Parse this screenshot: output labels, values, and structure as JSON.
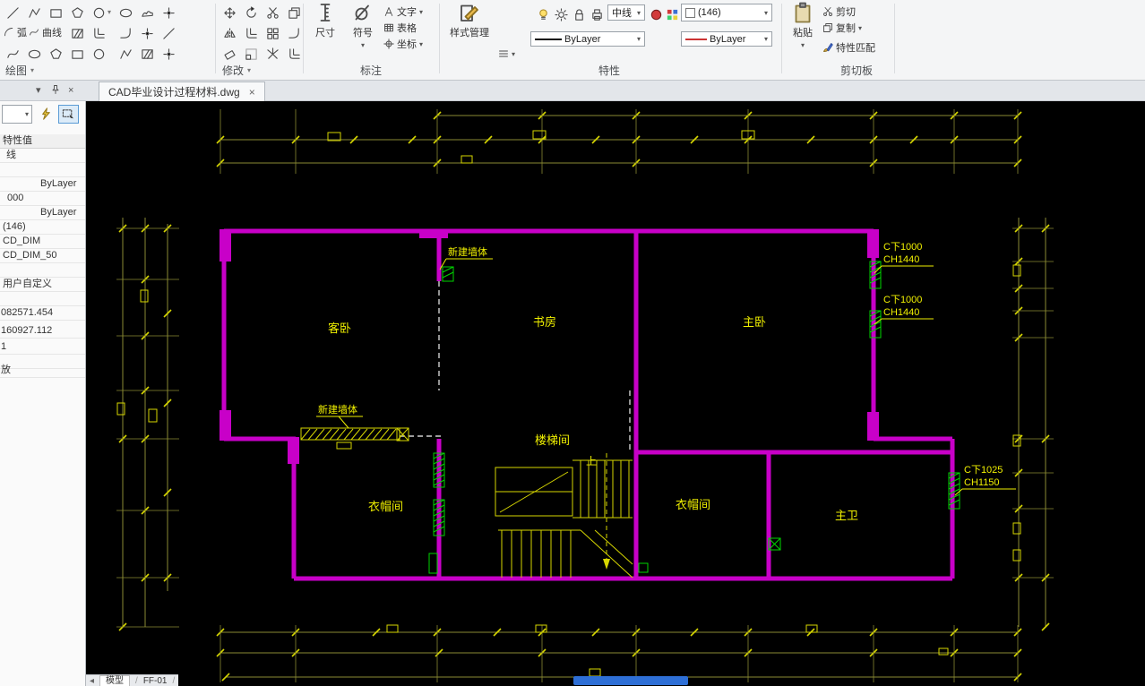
{
  "ribbon": {
    "group_labels": {
      "draw": "绘图",
      "modify": "修改",
      "annotate": "标注",
      "properties": "特性",
      "clipboard": "剪切板"
    },
    "draw_tools": {
      "arc": "弧",
      "curve": "曲线"
    },
    "annotate_tools": {
      "dimension": "尺寸",
      "symbol": "符号",
      "text": "文字",
      "table": "表格",
      "coordinate": "坐标"
    },
    "style_manager_label": "样式管理",
    "property_controls": {
      "linetype": "中线",
      "linetype_value": "ByLayer",
      "layer": "(146)",
      "color_value": "ByLayer"
    },
    "clipboard_tools": {
      "paste": "粘贴",
      "cut": "剪切",
      "copy": "复制",
      "match": "特性匹配"
    }
  },
  "tabbar": {
    "document_tab": "CAD毕业设计过程材料.dwg"
  },
  "left_panel": {
    "rows": [
      "特性值",
      "线",
      "ByLayer",
      "000",
      "ByLayer",
      "(146)",
      "CD_DIM",
      "CD_DIM_50",
      "用户自定义",
      "082571.454",
      "160927.112",
      "1",
      "放"
    ]
  },
  "plan": {
    "colors": {
      "walls": "#c800c8",
      "dims": "#8a8a33",
      "ticks": "#d6d600",
      "text": "#f0f000",
      "windows": "#00d400",
      "stairs": "#d6d600",
      "dashed": "#cfcfcf"
    },
    "rooms": [
      "客卧",
      "书房",
      "主卧",
      "楼梯间",
      "衣帽间",
      "衣帽间",
      "主卫"
    ],
    "up_label": "上",
    "new_wall_labels": [
      "新建墙体",
      "新建墙体"
    ],
    "window_labels": [
      {
        "line1": "C下1000",
        "line2": "CH1440"
      },
      {
        "line1": "C下1000",
        "line2": "CH1440"
      },
      {
        "line1": "C下1025",
        "line2": "CH1150"
      }
    ]
  },
  "statusbar": {
    "model_tab": "模型",
    "layout_tab": "FF-01"
  }
}
